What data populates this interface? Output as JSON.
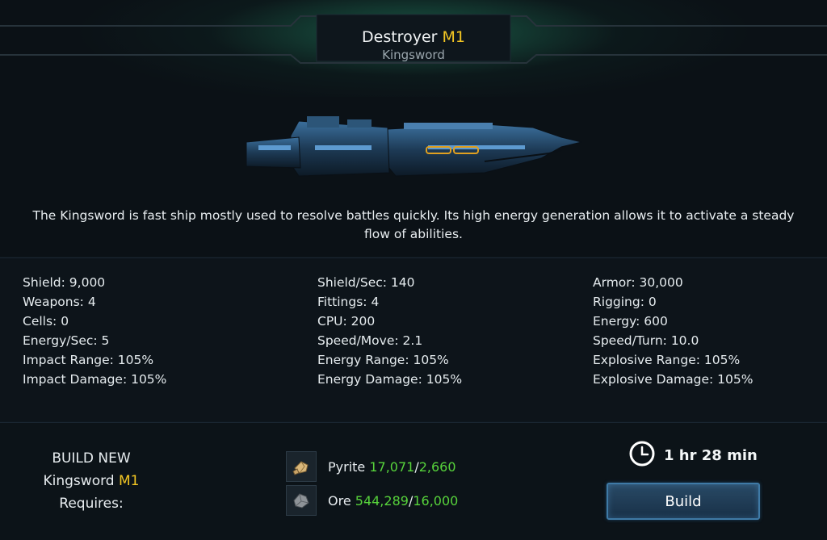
{
  "header": {
    "ship_class": "Destroyer",
    "tier": "M1",
    "ship_name": "Kingsword"
  },
  "description": "The Kingsword is fast ship mostly used to resolve battles quickly. Its high energy generation allows it to activate a steady flow of abilities.",
  "stats": {
    "col1": [
      "Shield: 9,000",
      "Weapons: 4",
      "Cells: 0",
      "Energy/Sec: 5",
      "Impact Range: 105%",
      "Impact Damage: 105%"
    ],
    "col2": [
      "Shield/Sec: 140",
      "Fittings: 4",
      "CPU: 200",
      "Speed/Move: 2.1",
      "Energy Range: 105%",
      "Energy Damage: 105%"
    ],
    "col3": [
      "Armor: 30,000",
      "Rigging: 0",
      "Energy: 600",
      "Speed/Turn: 10.0",
      "Explosive Range: 105%",
      "Explosive Damage: 105%"
    ]
  },
  "build": {
    "line1": "BUILD NEW",
    "ship_name": "Kingsword",
    "tier": "M1",
    "line3": "Requires:",
    "resources": [
      {
        "name": "Pyrite",
        "have": "17,071",
        "need": "2,660",
        "icon": "pyrite-icon"
      },
      {
        "name": "Ore",
        "have": "544,289",
        "need": "16,000",
        "icon": "ore-icon"
      }
    ],
    "time": "1 hr 28 min",
    "button_label": "Build"
  },
  "colors": {
    "accent_tier": "#f3c623",
    "resource_ok": "#57d33b",
    "button": "#294a66"
  }
}
